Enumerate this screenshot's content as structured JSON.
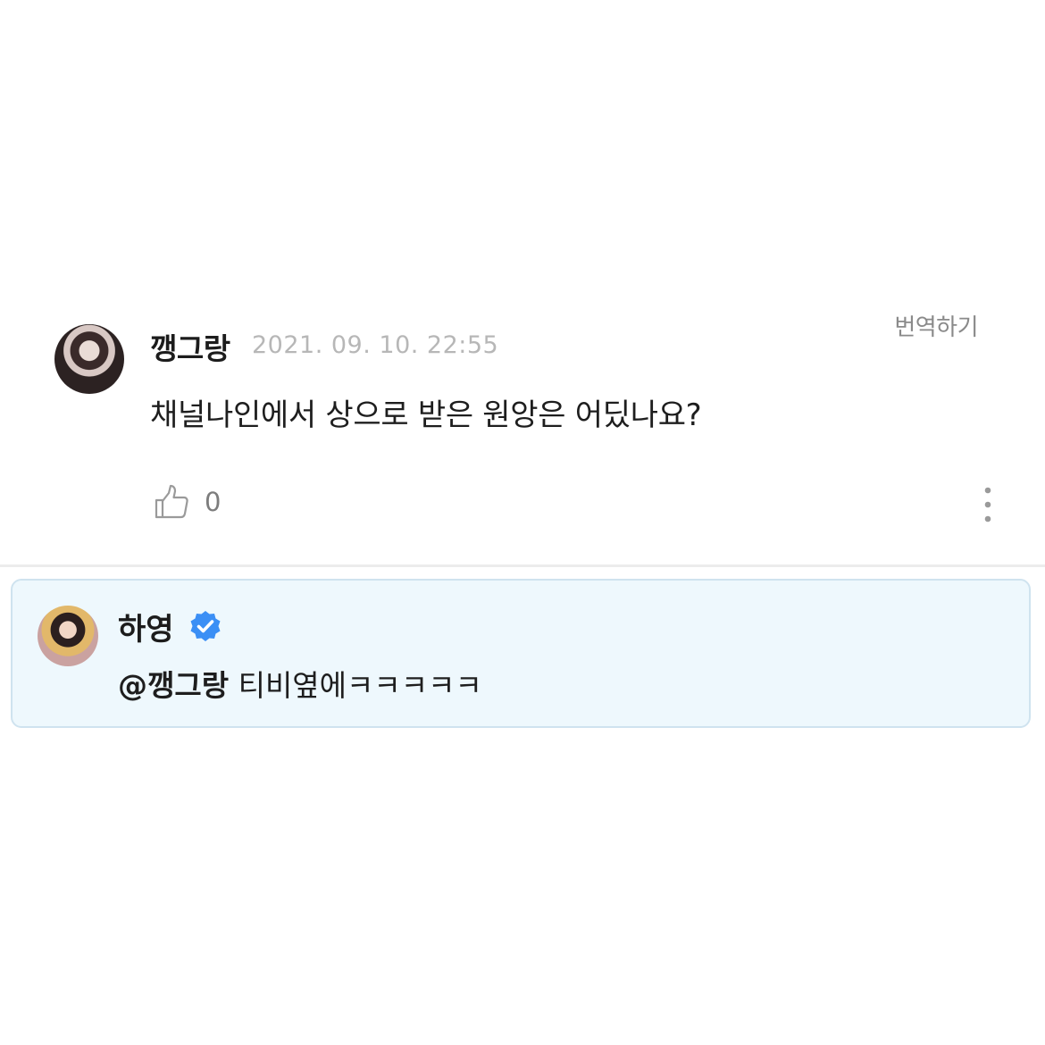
{
  "comment": {
    "username": "깽그랑",
    "timestamp": "2021. 09. 10. 22:55",
    "translate_label": "번역하기",
    "text": "채널나인에서 상으로 받은 원앙은 어딨나요?",
    "like_count": "0",
    "like_icon": "thumbs-up-icon",
    "more_icon": "more-vertical-icon"
  },
  "reply": {
    "username": "하영",
    "verified_icon": "verified-badge-icon",
    "verified_color": "#3b8ff5",
    "mention": "@깽그랑",
    "text": " 티비옆에ㅋㅋㅋㅋㅋ"
  },
  "colors": {
    "reply_background": "#eef8fd",
    "reply_border": "#cfe3ef",
    "timestamp": "#b7b7b7",
    "divider": "#ececec"
  }
}
